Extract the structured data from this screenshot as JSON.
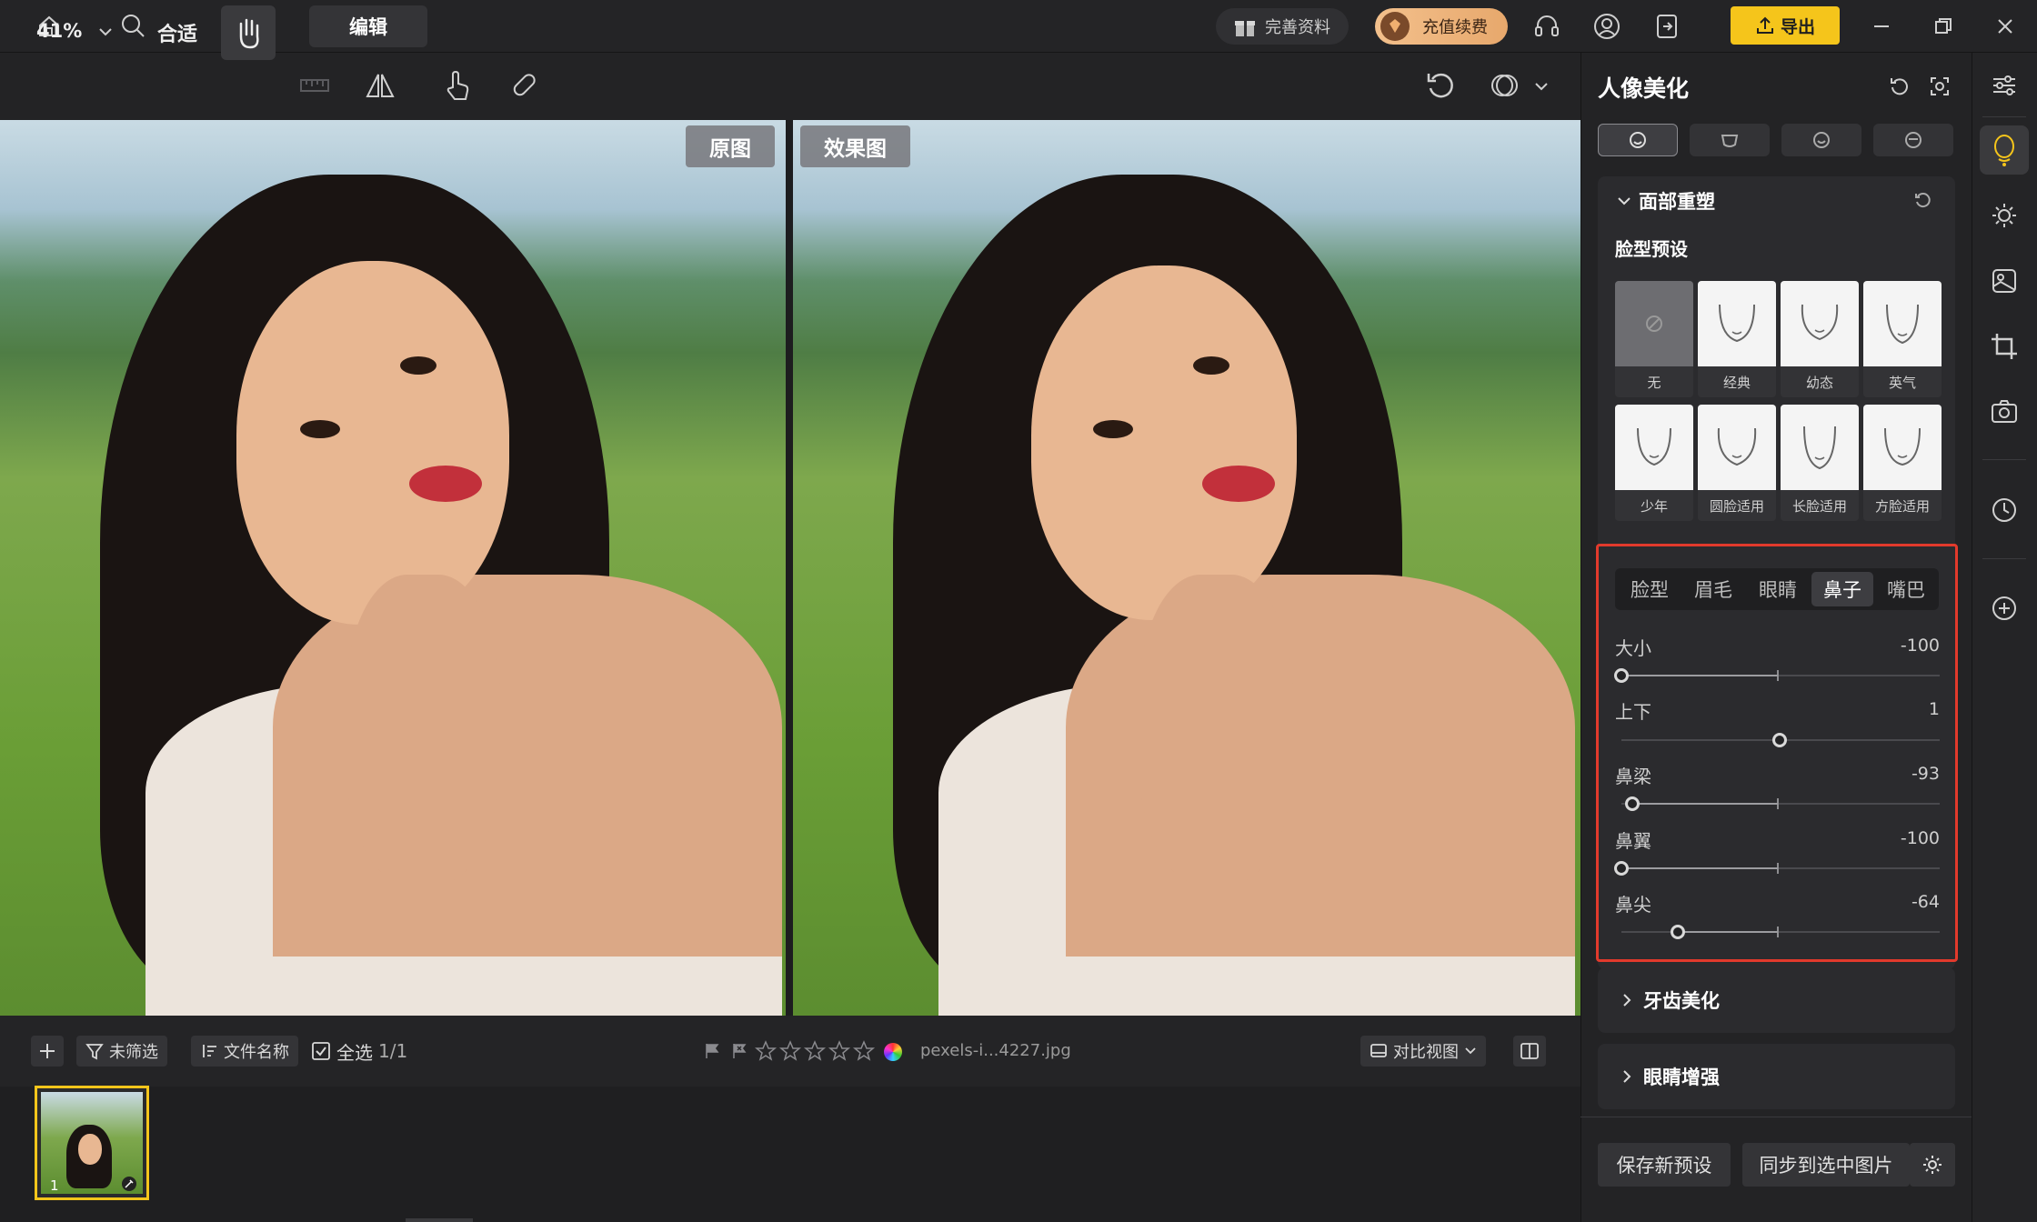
{
  "topbar": {
    "tabs": [
      {
        "label": "图库"
      },
      {
        "label": "编辑"
      }
    ],
    "complete_profile": "完善资料",
    "recharge": "充值续费",
    "export": "导出"
  },
  "toolbar": {
    "zoom": "41%",
    "fit": "合适"
  },
  "canvas": {
    "original_label": "原图",
    "result_label": "效果图"
  },
  "stripbar": {
    "filter": "未筛选",
    "sort": "文件名称",
    "select_all": "全选",
    "count": "1/1",
    "filename": "pexels-i...4227.jpg",
    "compare_view": "对比视图",
    "thumb_index": "1"
  },
  "panel": {
    "title": "人像美化",
    "face_section": {
      "title": "面部重塑",
      "preset_heading": "脸型预设",
      "presets": [
        {
          "label": "无"
        },
        {
          "label": "经典"
        },
        {
          "label": "幼态"
        },
        {
          "label": "英气"
        },
        {
          "label": "少年"
        },
        {
          "label": "圆脸适用"
        },
        {
          "label": "长脸适用"
        },
        {
          "label": "方脸适用"
        }
      ]
    },
    "feature_tabs": [
      {
        "label": "脸型"
      },
      {
        "label": "眉毛"
      },
      {
        "label": "眼睛"
      },
      {
        "label": "鼻子"
      },
      {
        "label": "嘴巴"
      }
    ],
    "active_feature": "鼻子",
    "sliders": [
      {
        "label": "大小",
        "value": "-100",
        "level": -100
      },
      {
        "label": "上下",
        "value": "1",
        "level": 1
      },
      {
        "label": "鼻梁",
        "value": "-93",
        "level": -93
      },
      {
        "label": "鼻翼",
        "value": "-100",
        "level": -100
      },
      {
        "label": "鼻尖",
        "value": "-64",
        "level": -64
      }
    ],
    "teeth_section": "牙齿美化",
    "eye_section": "眼睛增强",
    "save_preset": "保存新预设",
    "sync_button": "同步到选中图片"
  },
  "colors": {
    "accent": "#f5c51b",
    "highlight_box": "#e23a2c",
    "background": "#1f1f21"
  }
}
